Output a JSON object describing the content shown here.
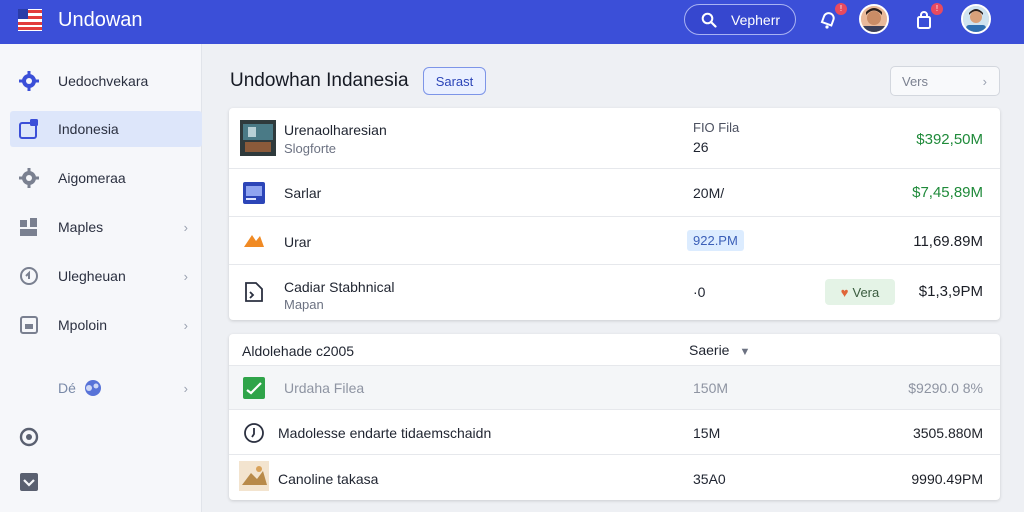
{
  "header": {
    "app_title": "Undowan",
    "search_label": "Vepherr",
    "notifications_badge": "!",
    "cart_badge": "!"
  },
  "sidebar": {
    "items": [
      {
        "label": "Uedochvekara",
        "icon": "gear-icon",
        "active": false,
        "chevron": false
      },
      {
        "label": "Indonesia",
        "icon": "folder-icon",
        "active": true,
        "chevron": false
      },
      {
        "label": "Aigomeraa",
        "icon": "settings-icon",
        "active": false,
        "chevron": false
      },
      {
        "label": "Maples",
        "icon": "grid-icon",
        "active": false,
        "chevron": true
      },
      {
        "label": "Ulegheuan",
        "icon": "refresh-icon",
        "active": false,
        "chevron": true
      },
      {
        "label": "Mpoloin",
        "icon": "box-icon",
        "active": false,
        "chevron": true
      },
      {
        "label": "Dé",
        "icon": "users-icon",
        "active": false,
        "chevron": true
      }
    ]
  },
  "main": {
    "title": "Undowhan Indanesia",
    "tag_label": "Sarast",
    "view_label": "Vers",
    "table1": {
      "rows": [
        {
          "name": "Urenaolharesian",
          "sub": "Slogforte",
          "mid": "FIO Fila",
          "mid2": "26",
          "value": "$392,50M",
          "value_color": "green"
        },
        {
          "name": "Sarlar",
          "mid": "20M/",
          "value": "$7,45,89M",
          "value_color": "green"
        },
        {
          "name": "Urar",
          "pill": "922.PM",
          "value": "11,69.89M",
          "value_color": "dark"
        },
        {
          "name": "Cadiar Stabhnical",
          "sub": "Mapan",
          "mid": "·0",
          "chip": "Vera",
          "value": "$1,3,9PM",
          "value_color": "dark"
        }
      ]
    },
    "table2": {
      "header": "Aldolehade c2005",
      "sort_label": "Saerie",
      "rows": [
        {
          "name": "Urdaha Filea",
          "mid": "150M",
          "value": "$9290.0 8%",
          "faded": true
        },
        {
          "name": "Madolesse endarte tidaemschaidn",
          "mid": "15M",
          "value": "3505.880M",
          "faded": false
        },
        {
          "name": "Canoline takasa",
          "mid": "35A0",
          "value": "9990.49PM",
          "faded": false
        }
      ]
    }
  },
  "colors": {
    "topbar": "#3b4fd8",
    "accent": "#2c45b8",
    "positive": "#1f8a3a",
    "active_nav": "#dde6fa"
  }
}
